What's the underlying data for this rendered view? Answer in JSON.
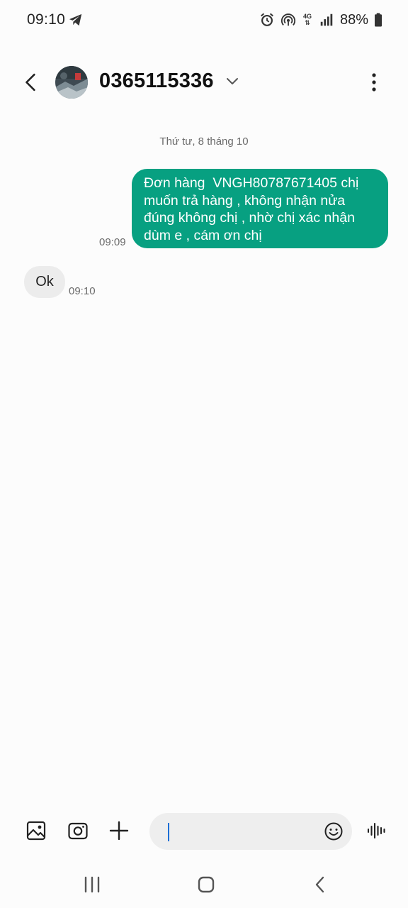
{
  "status_bar": {
    "time": "09:10",
    "battery_percent": "88%",
    "network_label": "4G",
    "icons": [
      "telegram-icon",
      "alarm-icon",
      "hotspot-icon",
      "4g-data-icon",
      "signal-icon",
      "battery-icon"
    ]
  },
  "header": {
    "contact_name": "0365115336",
    "icons": [
      "back-arrow-icon",
      "chevron-down-icon",
      "more-vert-icon"
    ]
  },
  "conversation": {
    "date_separator": "Thứ tư, 8 tháng 10",
    "messages": [
      {
        "direction": "outgoing",
        "text": "Đơn hàng  VNGH80787671405 chị muốn trả hàng , không nhận nửa đúng không chị , nhờ chị xác nhận dùm e , cám ơn chị",
        "time": "09:09"
      },
      {
        "direction": "incoming",
        "text": "Ok",
        "time": "09:10"
      }
    ]
  },
  "composer": {
    "input_value": "",
    "icons": [
      "gallery-icon",
      "camera-icon",
      "plus-icon",
      "emoji-icon",
      "voice-input-icon"
    ]
  },
  "nav_bar": {
    "icons": [
      "recent-apps-icon",
      "home-icon",
      "back-icon"
    ]
  },
  "colors": {
    "outgoing_bubble": "#07a081",
    "incoming_bubble": "#ececec",
    "background": "#fcfcfc",
    "caret": "#1d6fd6"
  }
}
